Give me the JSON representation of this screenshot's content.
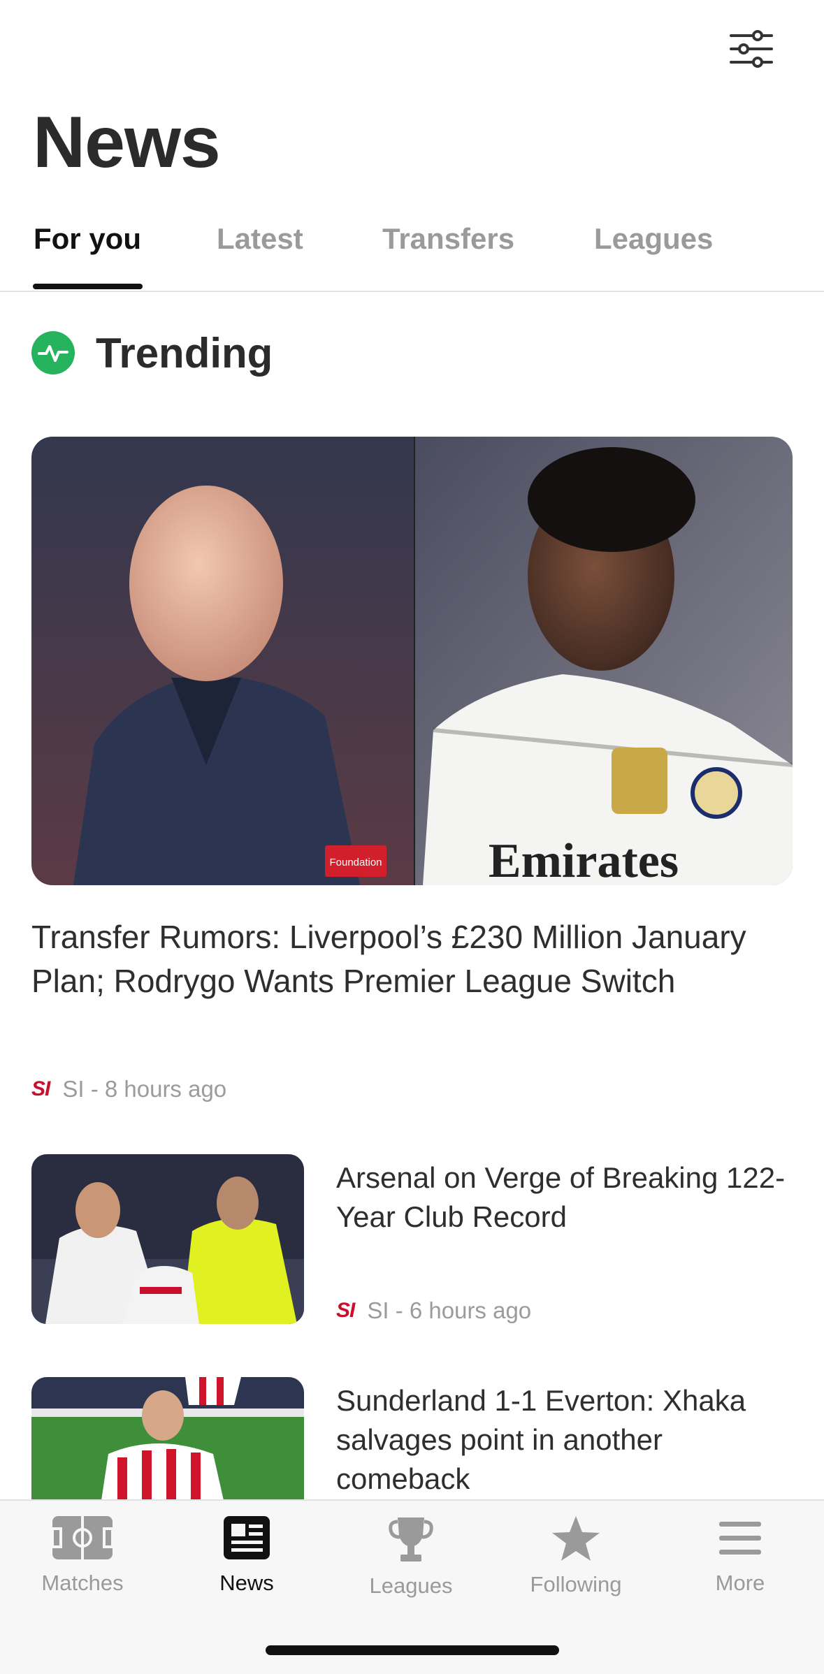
{
  "header": {
    "title": "News",
    "filter_icon": "sliders-icon"
  },
  "tabs": [
    {
      "label": "For you",
      "active": true
    },
    {
      "label": "Latest",
      "active": false
    },
    {
      "label": "Transfers",
      "active": false
    },
    {
      "label": "Leagues",
      "active": false
    }
  ],
  "trending": {
    "label": "Trending",
    "icon": "pulse-icon",
    "accent": "#25B35D"
  },
  "hero": {
    "title": "Transfer Rumors: Liverpool’s £230 Million January Plan; Rodrygo Wants Premier League Switch",
    "source_logo": "SI",
    "meta": "SI - 8 hours ago",
    "image_badge": "Foundation",
    "image_sponsor": "Emirates"
  },
  "stories": [
    {
      "title": "Arsenal on Verge of Breaking 122-Year Club Record",
      "source_logo": "SI",
      "meta": "SI - 6 hours ago"
    },
    {
      "title": "Sunderland 1-1 Everton: Xhaka salvages point in another comeback",
      "source_logo": "",
      "meta": ""
    }
  ],
  "bottom_nav": [
    {
      "label": "Matches",
      "icon": "pitch-icon",
      "active": false
    },
    {
      "label": "News",
      "icon": "newspaper-icon",
      "active": true
    },
    {
      "label": "Leagues",
      "icon": "trophy-icon",
      "active": false
    },
    {
      "label": "Following",
      "icon": "star-icon",
      "active": false
    },
    {
      "label": "More",
      "icon": "menu-icon",
      "active": false
    }
  ],
  "colors": {
    "brand_si": "#C8102E",
    "active_text": "#111111",
    "inactive_text": "#9A9A9A"
  }
}
